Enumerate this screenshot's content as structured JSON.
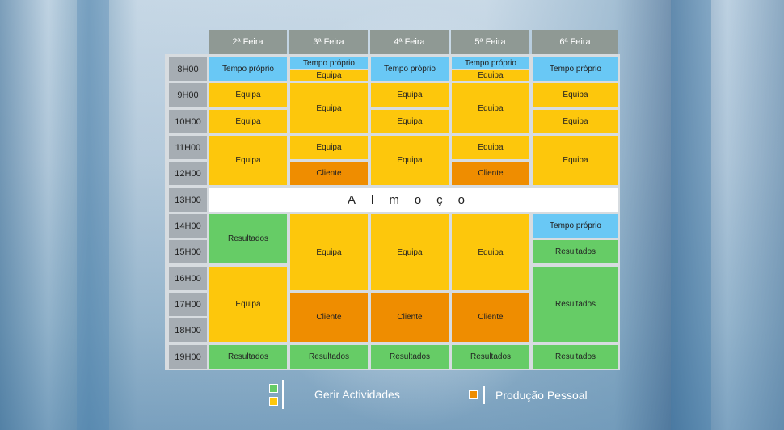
{
  "days": [
    "2ª Feira",
    "3ª Feira",
    "4ª Feira",
    "5ª Feira",
    "6ª Feira"
  ],
  "times": [
    "8H00",
    "9H00",
    "10H00",
    "11H00",
    "12H00",
    "13H00",
    "14H00",
    "15H00",
    "16H00",
    "17H00",
    "18H00",
    "19H00"
  ],
  "labels": {
    "tempo_proprio": "Tempo próprio",
    "equipa": "Equipa",
    "cliente": "Cliente",
    "resultados": "Resultados",
    "almoco": "Almoço"
  },
  "legend": {
    "gerir": "Gerir Actividades",
    "producao": "Produção Pessoal"
  },
  "colors": {
    "tempo_proprio": "#69c8f5",
    "equipa": "#fdc70c",
    "cliente": "#ef8d00",
    "resultados": "#66cc66",
    "header": "#8f9994",
    "time": "#a6adb3"
  }
}
